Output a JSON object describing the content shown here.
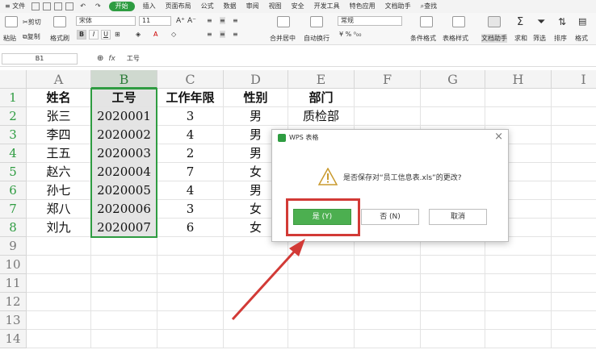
{
  "menubar": {
    "file": "文件",
    "tabs": [
      "开始",
      "插入",
      "页面布局",
      "公式",
      "数据",
      "审阅",
      "视图",
      "安全",
      "开发工具",
      "特色应用",
      "文档助手"
    ],
    "active_tab": "开始",
    "search": "查找"
  },
  "toolbar": {
    "paste": "粘贴",
    "cut": "剪切",
    "copy": "复制",
    "format_painter": "格式刷",
    "font_name": "宋体",
    "font_size": "11",
    "bold": "B",
    "italic": "I",
    "underline": "U",
    "merge_center": "合并居中",
    "wrap_text": "自动换行",
    "number_format": "常规",
    "conditional_format": "条件格式",
    "table_style": "表格样式",
    "doc_assistant": "文档助手",
    "sum": "求和",
    "filter": "筛选",
    "sort": "排序",
    "format": "格式"
  },
  "formula_bar": {
    "name_box": "B1",
    "fx_label": "fx",
    "value": "工号"
  },
  "sheet": {
    "columns": [
      "A",
      "B",
      "C",
      "D",
      "E",
      "F",
      "G",
      "H",
      "I"
    ],
    "rows": [
      "1",
      "2",
      "3",
      "4",
      "5",
      "6",
      "7",
      "8",
      "9",
      "10",
      "11",
      "12",
      "13",
      "14"
    ],
    "cells": [
      [
        "姓名",
        "工号",
        "工作年限",
        "性别",
        "部门"
      ],
      [
        "张三",
        "2020001",
        "3",
        "男",
        "质检部"
      ],
      [
        "李四",
        "2020002",
        "4",
        "男",
        ""
      ],
      [
        "王五",
        "2020003",
        "2",
        "男",
        ""
      ],
      [
        "赵六",
        "2020004",
        "7",
        "女",
        ""
      ],
      [
        "孙七",
        "2020005",
        "4",
        "男",
        ""
      ],
      [
        "郑八",
        "2020006",
        "3",
        "女",
        ""
      ],
      [
        "刘九",
        "2020007",
        "6",
        "女",
        ""
      ]
    ]
  },
  "dialog": {
    "title": "WPS 表格",
    "close": "×",
    "message": "是否保存对“员工信息表.xls”的更改?",
    "yes": "是 (Y)",
    "no": "否 (N)",
    "cancel": "取消"
  },
  "colors": {
    "accent": "#2e9c41",
    "annotation": "#d23a36"
  }
}
